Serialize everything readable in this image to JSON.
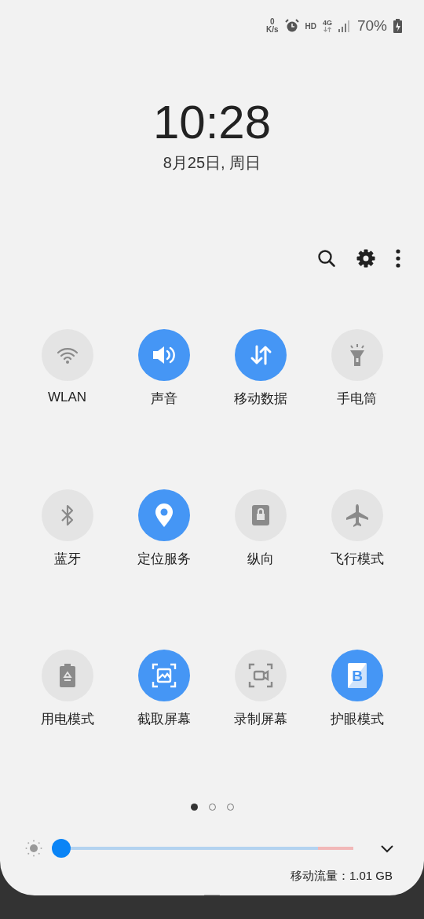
{
  "status_bar": {
    "net_speed_value": "0",
    "net_speed_unit": "K/s",
    "hd": "HD",
    "network": "4G",
    "battery": "70%"
  },
  "clock": {
    "time": "10:28",
    "date": "8月25日, 周日"
  },
  "tiles": [
    {
      "kind": "wifi",
      "label": "WLAN",
      "on": false
    },
    {
      "kind": "sound",
      "label": "声音",
      "on": true
    },
    {
      "kind": "data",
      "label": "移动数据",
      "on": true
    },
    {
      "kind": "flashlight",
      "label": "手电筒",
      "on": false
    },
    {
      "kind": "bluetooth",
      "label": "蓝牙",
      "on": false
    },
    {
      "kind": "location",
      "label": "定位服务",
      "on": true
    },
    {
      "kind": "rotation",
      "label": "纵向",
      "on": false
    },
    {
      "kind": "airplane",
      "label": "飞行模式",
      "on": false
    },
    {
      "kind": "power",
      "label": "用电模式",
      "on": false
    },
    {
      "kind": "screenshot",
      "label": "截取屏幕",
      "on": true
    },
    {
      "kind": "record",
      "label": "录制屏幕",
      "on": false
    },
    {
      "kind": "eyecare",
      "label": "护眼模式",
      "on": true,
      "glyph": "B"
    }
  ],
  "pages": [
    {
      "selected": true
    },
    {
      "selected": false
    },
    {
      "selected": false
    }
  ],
  "brightness": {
    "level": 0
  },
  "data_usage": "移动流量：1.01 GB"
}
